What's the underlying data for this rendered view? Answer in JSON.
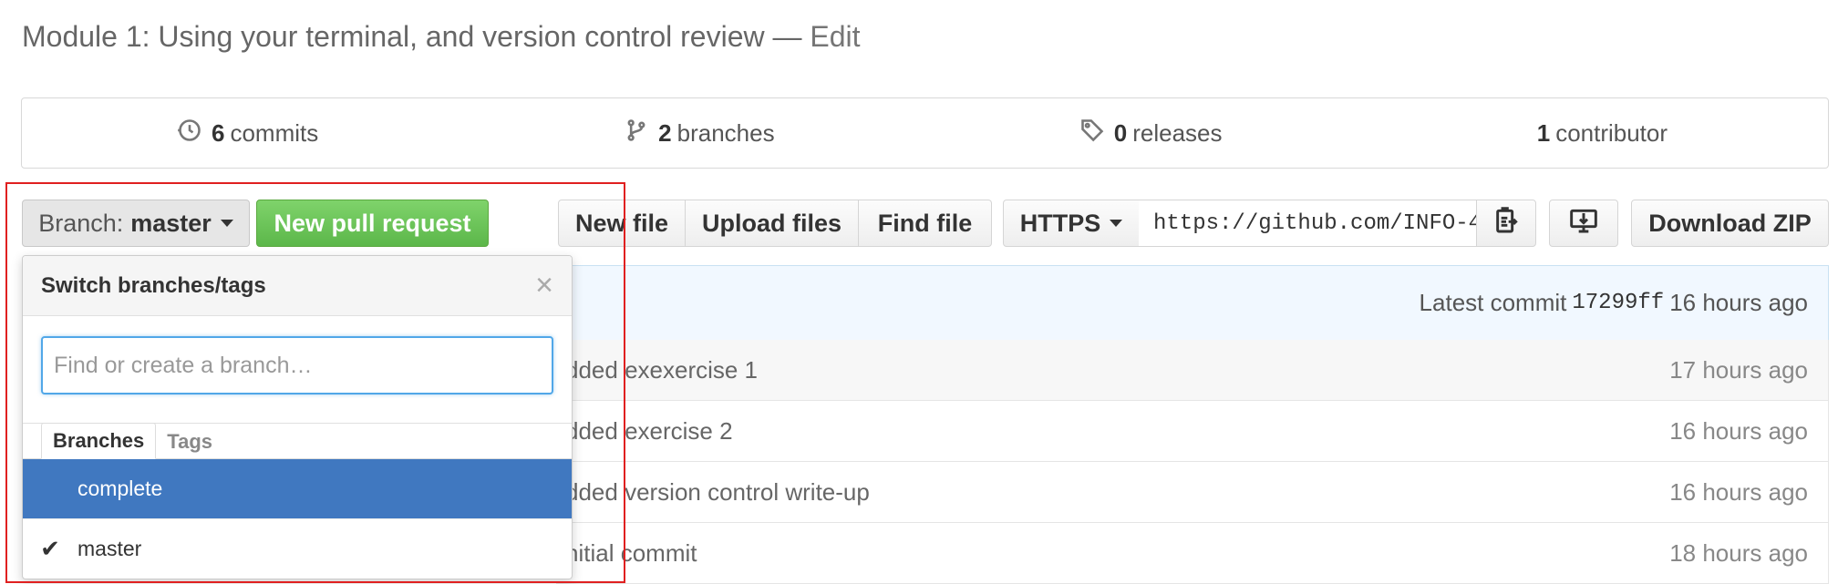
{
  "repo": {
    "description": "Module 1: Using your terminal, and version control review",
    "separator": "—",
    "edit_label": "Edit"
  },
  "summary": {
    "commits": {
      "count": "6",
      "label": "commits",
      "icon": "history-icon"
    },
    "branches": {
      "count": "2",
      "label": "branches",
      "icon": "branch-icon"
    },
    "releases": {
      "count": "0",
      "label": "releases",
      "icon": "tag-icon"
    },
    "contributors": {
      "count": "1",
      "label": "contributor"
    }
  },
  "toolbar": {
    "branch_prefix": "Branch:",
    "branch_name": "master",
    "new_pr_label": "New pull request",
    "new_file_label": "New file",
    "upload_files_label": "Upload files",
    "find_file_label": "Find file",
    "protocol_label": "HTTPS",
    "clone_url": "https://github.com/INFO-4",
    "download_zip_label": "Download ZIP"
  },
  "latest_commit": {
    "prefix": "Latest commit",
    "sha": "17299ff",
    "age": "16 hours ago"
  },
  "files": [
    {
      "message": "dded exexercise 1",
      "age": "17 hours ago"
    },
    {
      "message": "dded exercise 2",
      "age": "16 hours ago"
    },
    {
      "message": "dded version control write-up",
      "age": "16 hours ago"
    },
    {
      "message": "nitial commit",
      "age": "18 hours ago"
    }
  ],
  "dropdown": {
    "title": "Switch branches/tags",
    "close_glyph": "×",
    "filter_placeholder": "Find or create a branch…",
    "tabs": [
      {
        "label": "Branches"
      },
      {
        "label": "Tags"
      }
    ],
    "items": [
      {
        "label": "complete",
        "checked": false,
        "selected": true
      },
      {
        "label": "master",
        "checked": true,
        "selected": false
      }
    ],
    "check_glyph": "✔"
  },
  "colors": {
    "accent_blue": "#4078c0",
    "pr_green": "#5cb74a",
    "highlight_red": "#e02020"
  }
}
